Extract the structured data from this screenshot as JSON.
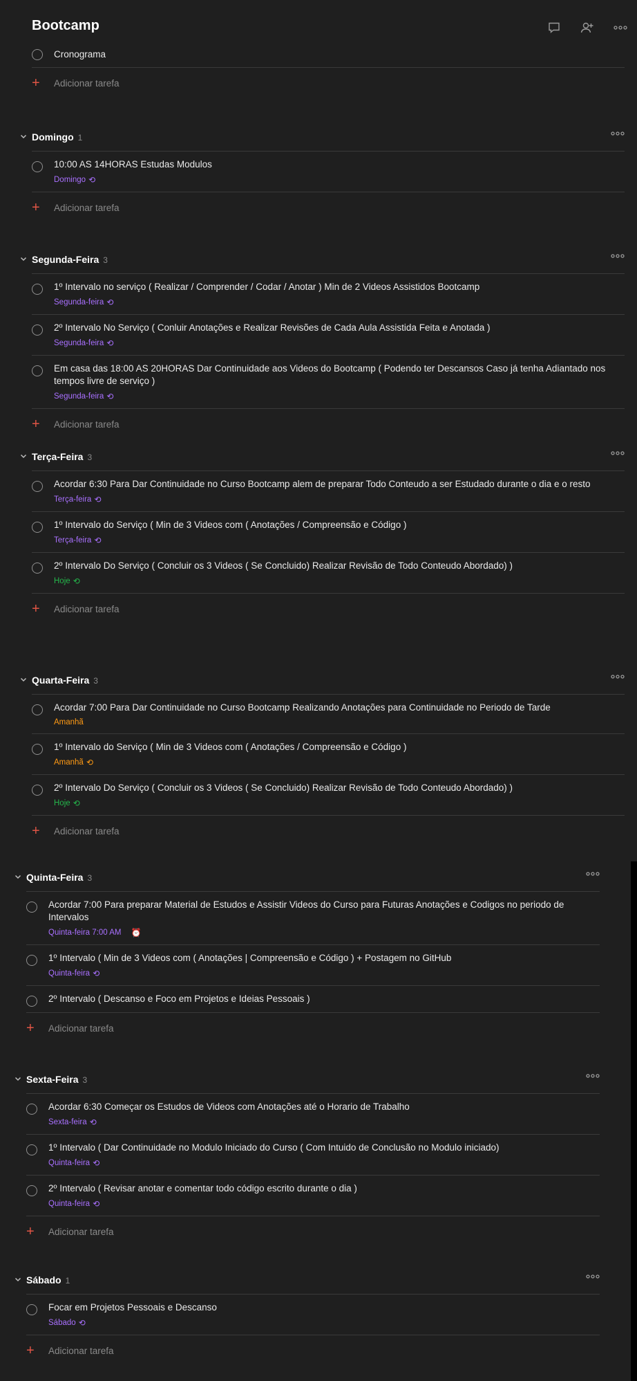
{
  "project": {
    "title": "Bootcamp"
  },
  "header_icons": [
    "comment-icon",
    "add-person-icon",
    "more-icon"
  ],
  "colors": {
    "purple": "#a970ff",
    "orange": "#ff9a14",
    "green": "#25b84c",
    "add": "#e05545"
  },
  "top": {
    "tasks": [
      {
        "text": "Cronograma"
      }
    ],
    "add_label": "Adicionar tarefa"
  },
  "sections": [
    {
      "name": "Domingo",
      "count": "1",
      "add_label": "Adicionar tarefa",
      "tasks": [
        {
          "text": "10:00 AS 14HORAS Estudas Modulos",
          "date": "Domingo",
          "date_color": "#a970ff",
          "recurring": true
        }
      ]
    },
    {
      "name": "Segunda-Feira",
      "count": "3",
      "add_label": "Adicionar tarefa",
      "tasks": [
        {
          "text": "1º Intervalo no serviço ( Realizar / Comprender / Codar / Anotar ) Min de 2 Videos Assistidos Bootcamp",
          "date": "Segunda-feira",
          "date_color": "#a970ff",
          "recurring": true
        },
        {
          "text": "2º Intervalo No Serviço ( Conluir Anotações e Realizar Revisões de Cada Aula Assistida Feita e Anotada )",
          "date": "Segunda-feira",
          "date_color": "#a970ff",
          "recurring": true
        },
        {
          "text": "Em casa das 18:00 AS 20HORAS Dar Continuidade aos Videos do Bootcamp ( Podendo ter Descansos Caso já tenha Adiantado nos tempos livre de serviço )",
          "date": "Segunda-feira",
          "date_color": "#a970ff",
          "recurring": true
        }
      ]
    },
    {
      "name": "Terça-Feira",
      "count": "3",
      "add_label": "Adicionar tarefa",
      "tasks": [
        {
          "text": "Acordar 6:30 Para Dar Continuidade no Curso Bootcamp alem de preparar Todo Conteudo a ser Estudado durante o dia e o resto",
          "date": "Terça-feira",
          "date_color": "#a970ff",
          "recurring": true
        },
        {
          "text": "1º Intervalo do Serviço ( Min de 3 Videos com ( Anotações / Compreensão e Código )",
          "date": "Terça-feira",
          "date_color": "#a970ff",
          "recurring": true
        },
        {
          "text": "2º Intervalo Do Serviço ( Concluir os 3 Videos ( Se Concluido) Realizar Revisão de Todo Conteudo Abordado) )",
          "date": "Hoje",
          "date_color": "#25b84c",
          "recurring": true
        }
      ]
    },
    {
      "name": "Quarta-Feira",
      "count": "3",
      "add_label": "Adicionar tarefa",
      "tasks": [
        {
          "text": "Acordar 7:00 Para Dar Continuidade no Curso Bootcamp Realizando Anotações para Continuidade no Periodo de Tarde",
          "date": "Amanhã",
          "date_color": "#ff9a14",
          "recurring": false
        },
        {
          "text": "1º Intervalo do Serviço ( Min de 3 Videos com ( Anotações / Compreensão e Código )",
          "date": "Amanhã",
          "date_color": "#ff9a14",
          "recurring": true
        },
        {
          "text": "2º Intervalo Do Serviço ( Concluir os 3 Videos ( Se Concluido) Realizar Revisão de Todo Conteudo Abordado) )",
          "date": "Hoje",
          "date_color": "#25b84c",
          "recurring": true
        }
      ]
    },
    {
      "name": "Quinta-Feira",
      "count": "3",
      "add_label": "Adicionar tarefa",
      "tasks": [
        {
          "text": "Acordar 7:00 Para preparar Material de Estudos e Assistir Videos do Curso para Futuras Anotações e Codigos no periodo de Intervalos",
          "date": "Quinta-feira 7:00 AM",
          "date_color": "#a970ff",
          "recurring": false,
          "alarm": true
        },
        {
          "text": "1º Intervalo ( Min de 3 Videos com ( Anotações | Compreensão e Código ) + Postagem no GitHub",
          "date": "Quinta-feira",
          "date_color": "#a970ff",
          "recurring": true
        },
        {
          "text": "2º Intervalo ( Descanso e Foco em Projetos e Ideias Pessoais )"
        }
      ]
    },
    {
      "name": "Sexta-Feira",
      "count": "3",
      "add_label": "Adicionar tarefa",
      "tasks": [
        {
          "text": "Acordar 6:30 Começar os Estudos de Videos com Anotações até o Horario de Trabalho",
          "date": "Sexta-feira",
          "date_color": "#a970ff",
          "recurring": true
        },
        {
          "text": "1º Intervalo ( Dar Continuidade no Modulo Iniciado do Curso ( Com Intuido de Conclusão no Modulo iniciado)",
          "date": "Quinta-feira",
          "date_color": "#a970ff",
          "recurring": true
        },
        {
          "text": "2º Intervalo ( Revisar anotar e comentar todo código escrito durante o dia )",
          "date": "Quinta-feira",
          "date_color": "#a970ff",
          "recurring": true
        }
      ]
    },
    {
      "name": "Sábado",
      "count": "1",
      "add_label": "Adicionar tarefa",
      "tasks": [
        {
          "text": "Focar em Projetos Pessoais e Descanso",
          "date": "Sábado",
          "date_color": "#a970ff",
          "recurring": true
        }
      ]
    }
  ]
}
